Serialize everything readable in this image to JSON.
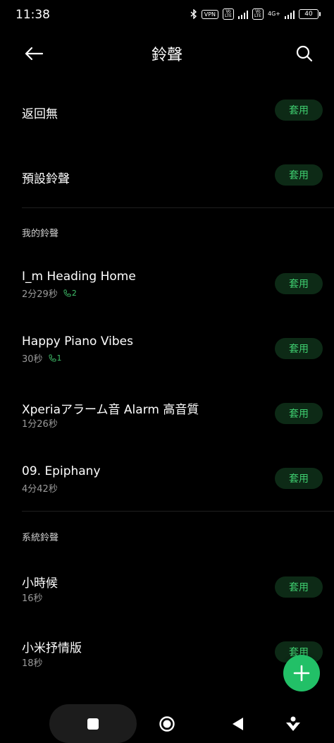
{
  "status_bar": {
    "time": "11:38",
    "vpn": "VPN",
    "volte1": "Vo LTE",
    "volte2": "Vo LTE",
    "network": "4G+",
    "battery": "40"
  },
  "header": {
    "title": "鈴聲"
  },
  "top_items": [
    {
      "title": "返回無",
      "action": "套用"
    },
    {
      "title": "預設鈴聲",
      "action": "套用"
    }
  ],
  "my_ringtones": {
    "header": "我的鈴聲",
    "items": [
      {
        "title": "I_m Heading Home",
        "duration": "2分29秒",
        "calls": "2",
        "action": "套用"
      },
      {
        "title": "Happy Piano Vibes",
        "duration": "30秒",
        "calls": "1",
        "action": "套用"
      },
      {
        "title": "Xperiaアラーム音 Alarm 高音質",
        "duration": "1分26秒",
        "action": "套用"
      },
      {
        "title": "09. Epiphany",
        "duration": "4分42秒",
        "action": "套用"
      }
    ]
  },
  "system_ringtones": {
    "header": "系統鈴聲",
    "items": [
      {
        "title": "小時候",
        "duration": "16秒",
        "action": "套用"
      },
      {
        "title": "小米抒情版",
        "duration": "18秒",
        "action": "套用"
      }
    ]
  },
  "colors": {
    "accent": "#3fcf70",
    "fab": "#22c067",
    "apply_bg": "#0d2a16",
    "background": "#000000"
  },
  "icons": {
    "back": "arrow-left-icon",
    "search": "search-icon",
    "fab": "plus-icon",
    "nav_recents": "square-icon",
    "nav_home": "circle-icon",
    "nav_back": "triangle-icon",
    "nav_assist": "assistant-icon",
    "call": "phone-icon"
  }
}
